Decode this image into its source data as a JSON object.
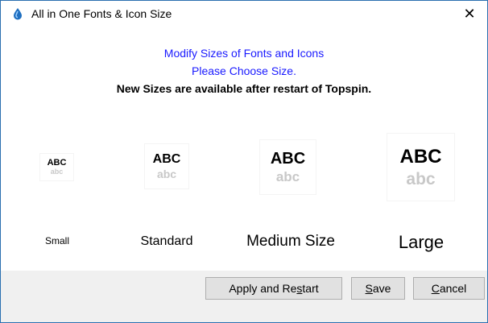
{
  "window": {
    "title": "All in One Fonts & Icon Size",
    "close_glyph": "✕",
    "app_icon": "topspin-drop-icon",
    "border_color": "#2a6fb0"
  },
  "header": {
    "line1": "Modify Sizes of Fonts and Icons",
    "line2": "Please Choose Size.",
    "line3": "New Sizes are available after restart of Topspin.",
    "accent_color": "#1a1aff"
  },
  "sizes": [
    {
      "id": "small",
      "preview_upper": "ABC",
      "preview_lower": "abc",
      "label": "Small"
    },
    {
      "id": "standard",
      "preview_upper": "ABC",
      "preview_lower": "abc",
      "label": "Standard"
    },
    {
      "id": "medium",
      "preview_upper": "ABC",
      "preview_lower": "abc",
      "label": "Medium Size"
    },
    {
      "id": "large",
      "preview_upper": "ABC",
      "preview_lower": "abc",
      "label": "Large"
    }
  ],
  "buttons": {
    "apply": {
      "pre": "Apply and Re",
      "mnemonic": "s",
      "post": "tart"
    },
    "save": {
      "pre": "",
      "mnemonic": "S",
      "post": "ave"
    },
    "cancel": {
      "pre": "",
      "mnemonic": "C",
      "post": "ancel"
    }
  }
}
